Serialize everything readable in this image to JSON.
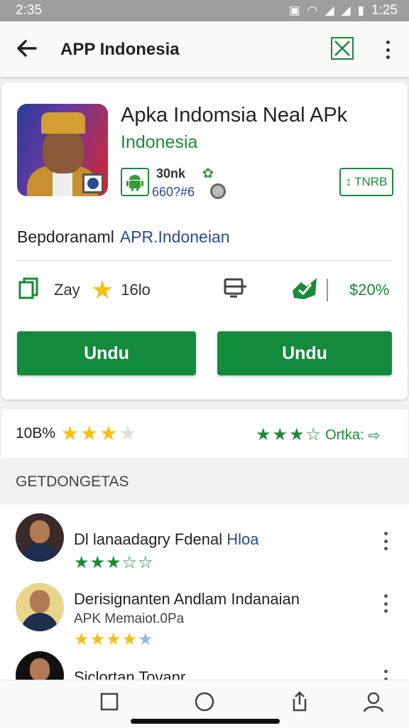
{
  "status_bar": {
    "time_left": "2:35",
    "time_right": "1:25"
  },
  "app_bar": {
    "title": "APP Indonesia",
    "back_icon": "arrow-left-icon",
    "action_icon": "close-box-icon",
    "menu_icon": "more-vert-icon"
  },
  "app": {
    "title": "Apka Indomsia Neal APk",
    "developer": "Indonesia",
    "downloads": "30nk",
    "version": "660?#6",
    "size_label": "TNRB",
    "description": "Bepdoranaml",
    "description_link": "APR.Indoneian"
  },
  "stats": {
    "item1": "Zay",
    "item2": "16lo",
    "item4": "$20%"
  },
  "buttons": {
    "left": "Undu",
    "right": "Undu"
  },
  "rating": {
    "label": "10B%",
    "stars_filled": 3,
    "stars_total": 4,
    "right_label": "Ortka:",
    "right_stars": 4
  },
  "section": {
    "header": "GETDONGETAS"
  },
  "list": [
    {
      "name_main": "Dl lanaadagry Fdenal",
      "name_link": "Hloa",
      "subtitle": "",
      "stars": 3
    },
    {
      "name_main": "Derisignanten Andlam Indanaian",
      "name_link": "",
      "subtitle": "APK Memaiot.0Pa",
      "stars": 4
    },
    {
      "name_main": "Siclortan Tovanr",
      "name_link": "",
      "subtitle": "",
      "stars": 0
    }
  ],
  "colors": {
    "accent": "#148a3d",
    "star_gold": "#f4c20d",
    "link_blue": "#2a4b8c"
  }
}
